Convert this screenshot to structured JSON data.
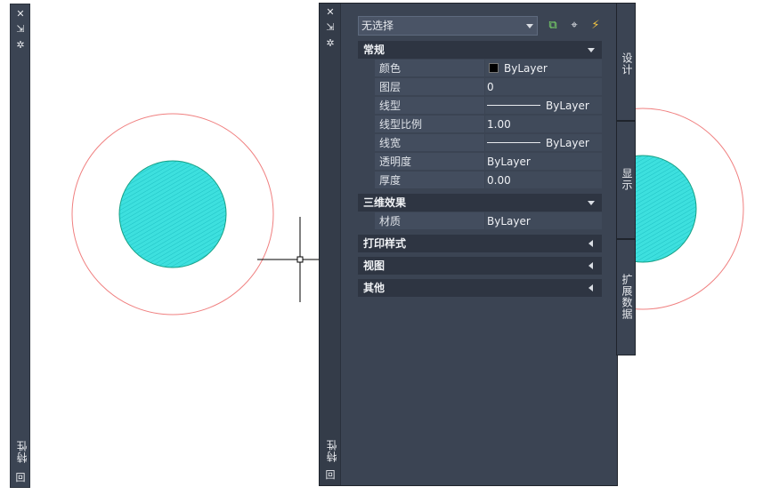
{
  "left_palette": {
    "close_glyph": "✕",
    "pin_glyph": "⇲",
    "settings_glyph": "✲",
    "title": "特性",
    "bottom_glyph": "回"
  },
  "palette": {
    "close_glyph": "✕",
    "pin_glyph": "⇲",
    "settings_glyph": "✲",
    "title": "特性",
    "bottom_glyph": "回",
    "selection": "无选择",
    "tools": {
      "toggle_pickadd": "⧉",
      "select_objects": "⌖",
      "quick_select": "⚡"
    },
    "sections": {
      "general": {
        "label": "常规",
        "rows": [
          {
            "name": "颜色",
            "value": "ByLayer"
          },
          {
            "name": "图层",
            "value": "0"
          },
          {
            "name": "线型",
            "value": "ByLayer"
          },
          {
            "name": "线型比例",
            "value": "1.00"
          },
          {
            "name": "线宽",
            "value": "ByLayer"
          },
          {
            "name": "透明度",
            "value": "ByLayer"
          },
          {
            "name": "厚度",
            "value": "0.00"
          }
        ]
      },
      "three_d": {
        "label": "三维效果",
        "rows": [
          {
            "name": "材质",
            "value": "ByLayer"
          }
        ]
      },
      "plot_style": {
        "label": "打印样式"
      },
      "view": {
        "label": "视图"
      },
      "misc": {
        "label": "其他"
      }
    },
    "tabs": {
      "design": "设计",
      "display": "显示",
      "extended_data": "扩展数据"
    }
  },
  "colors": {
    "outer_circle": "#f08080",
    "hatch_fill": "#3de0de",
    "hatch_edge": "#16a085",
    "crosshair": "#000000"
  }
}
